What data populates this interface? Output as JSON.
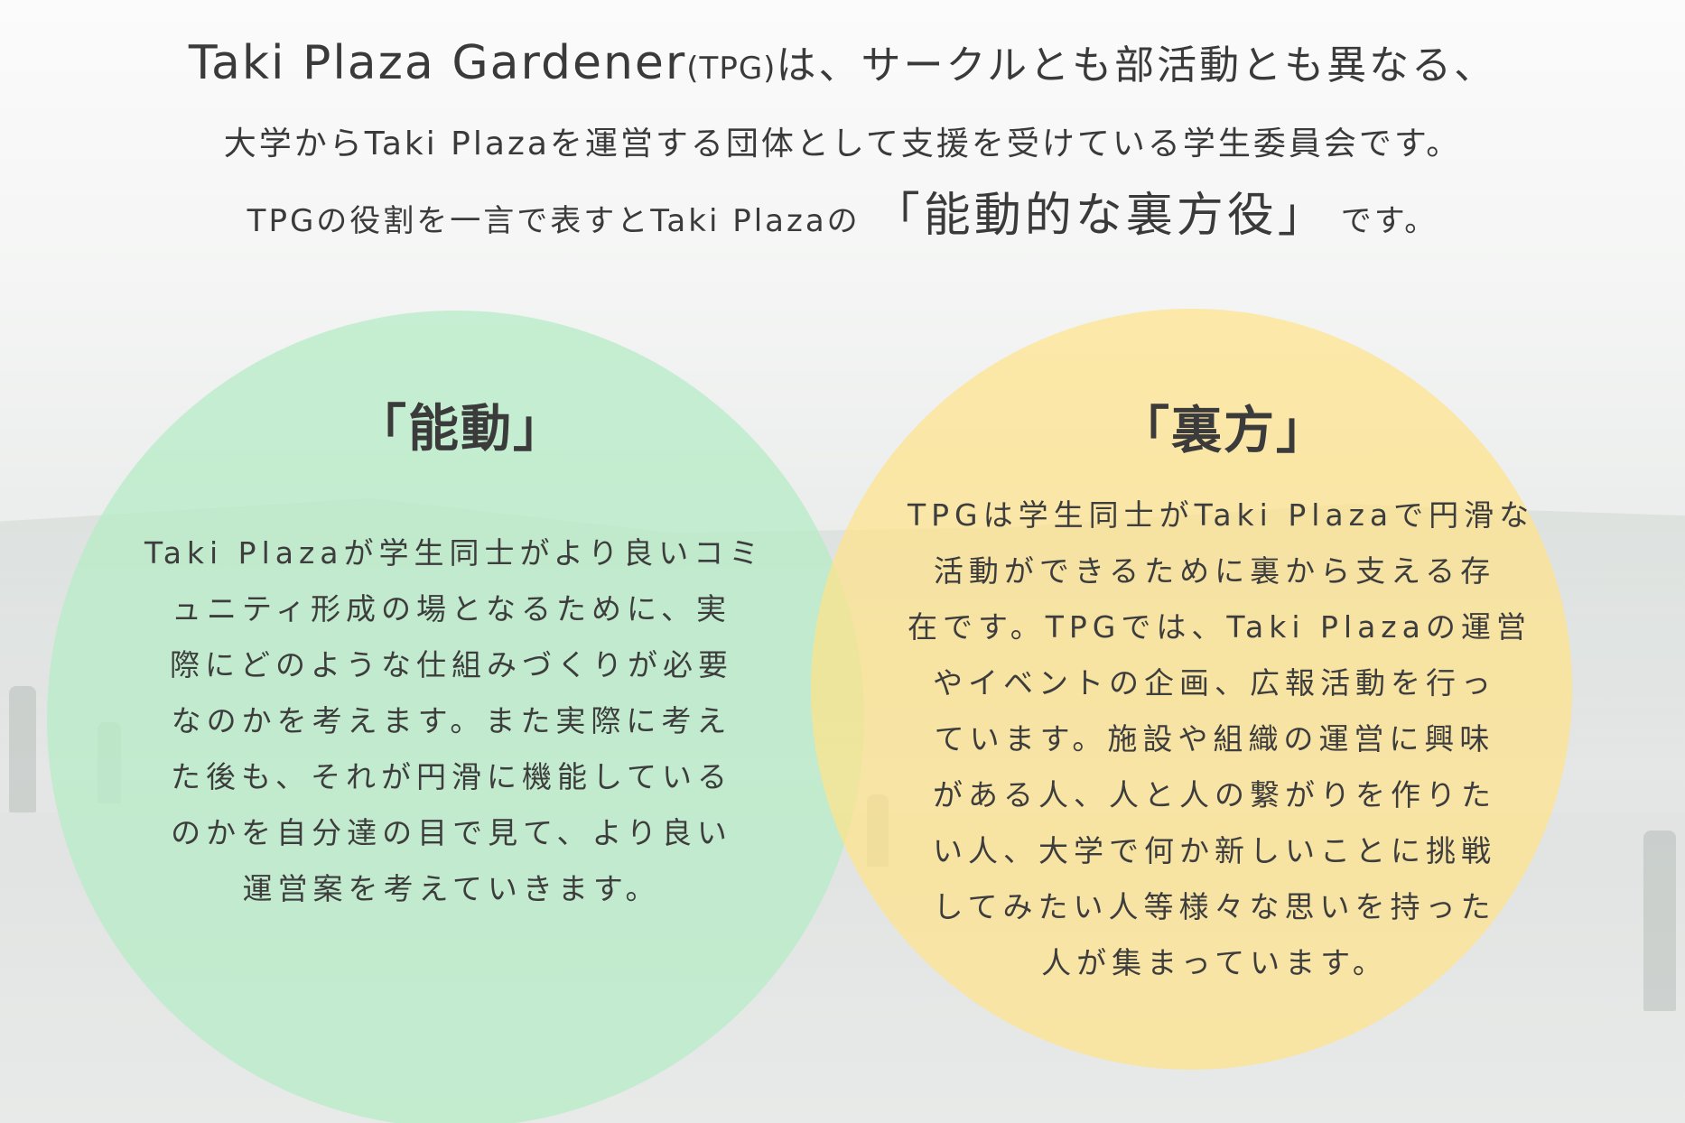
{
  "intro": {
    "line1_brand": "Taki Plaza Gardener",
    "line1_abbr": "(TPG)",
    "line1_rest": "は、サークルとも部活動とも異なる、",
    "line2": "大学からTaki Plazaを運営する団体として支援を受けている学生委員会です。",
    "line3_before": "TPGの役割を一言で表すとTaki Plazaの",
    "line3_emphasis": "「能動的な裏方役」",
    "line3_after": "です。"
  },
  "circles": {
    "active": {
      "title": "「能動」",
      "lines": [
        "Taki Plazaが学生同士がより良いコミ",
        "ュニティ形成の場となるために、実",
        "際にどのような仕組みづくりが必要",
        "なのかを考えます。また実際に考え",
        "た後も、それが円滑に機能している",
        "のかを自分達の目で見て、より良い",
        "運営案を考えていきます。"
      ]
    },
    "behind": {
      "title": "「裏方」",
      "lines": [
        "TPGは学生同士がTaki Plazaで円滑な",
        "活動ができるために裏から支える存",
        "在です。TPGでは、Taki Plazaの運営",
        "やイベントの企画、広報活動を行っ",
        "ています。施設や組織の運営に興味",
        "がある人、人と人の繋がりを作りた",
        "い人、大学で何か新しいことに挑戦",
        "してみたい人等様々な思いを持った",
        "人が集まっています。"
      ]
    }
  },
  "colors": {
    "green_circle": "#b8ecc8",
    "yellow_circle": "#ffe38a",
    "text": "#3a3a3a"
  }
}
